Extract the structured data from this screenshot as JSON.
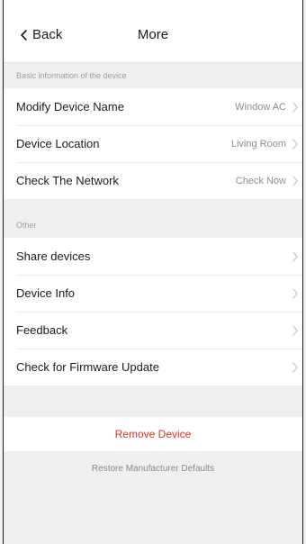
{
  "nav": {
    "back_label": "Back",
    "title": "More"
  },
  "section_basic": {
    "header": "Basic information of the device",
    "items": [
      {
        "label": "Modify Device Name",
        "value": "Window AC"
      },
      {
        "label": "Device Location",
        "value": "Living Room"
      },
      {
        "label": "Check The Network",
        "value": "Check Now"
      }
    ]
  },
  "section_other": {
    "header": "Other",
    "items": [
      {
        "label": "Share devices"
      },
      {
        "label": "Device Info"
      },
      {
        "label": "Feedback"
      },
      {
        "label": "Check for Firmware Update"
      }
    ]
  },
  "actions": {
    "remove_label": "Remove Device",
    "restore_label": "Restore Manufacturer Defaults"
  },
  "colors": {
    "danger": "#e0312e",
    "muted": "#8c8c8c",
    "background": "#efeff0"
  },
  "icons": {
    "back": "chevron-left-icon",
    "row_arrow": "chevron-right-icon"
  }
}
